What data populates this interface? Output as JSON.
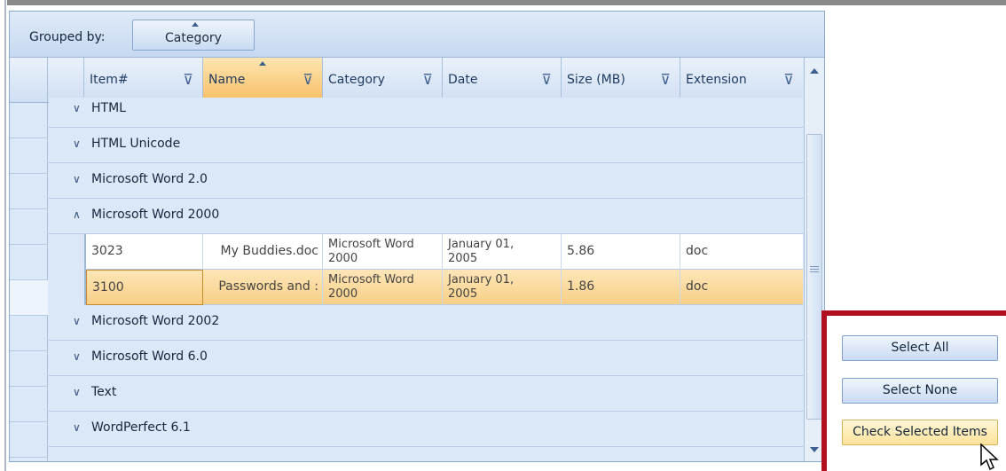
{
  "group_panel": {
    "label": "Grouped by:",
    "chip": "Category"
  },
  "columns": [
    {
      "label": "Item#",
      "sorted": false
    },
    {
      "label": "Name",
      "sorted": true
    },
    {
      "label": "Category",
      "sorted": false
    },
    {
      "label": "Date",
      "sorted": false
    },
    {
      "label": "Size (MB)",
      "sorted": false
    },
    {
      "label": "Extension",
      "sorted": false
    }
  ],
  "groups": [
    {
      "label": "HTML",
      "expanded": false
    },
    {
      "label": "HTML Unicode",
      "expanded": false
    },
    {
      "label": "Microsoft Word 2.0",
      "expanded": false
    },
    {
      "label": "Microsoft Word 2000",
      "expanded": true
    },
    {
      "label": "Microsoft Word 2002",
      "expanded": false
    },
    {
      "label": "Microsoft Word 6.0",
      "expanded": false
    },
    {
      "label": "Text",
      "expanded": false
    },
    {
      "label": "WordPerfect 6.1",
      "expanded": false
    }
  ],
  "rows": [
    {
      "item": "3023",
      "name": "My Buddies.doc",
      "category_line1": "Microsoft Word",
      "category_line2": "2000",
      "date_line1": "January 01,",
      "date_line2": "2005",
      "size": "5.86",
      "extension": "doc",
      "selected": false
    },
    {
      "item": "3100",
      "name": "Passwords and :",
      "category_line1": "Microsoft Word",
      "category_line2": "2000",
      "date_line1": "January 01,",
      "date_line2": "2005",
      "size": "1.86",
      "extension": "doc",
      "selected": true
    }
  ],
  "buttons": {
    "select_all": "Select All",
    "select_none": "Select None",
    "check_selected": "Check Selected Items"
  },
  "colors": {
    "selected_row": "#f9cf86",
    "highlight_border": "#b01020",
    "hot_button": "#fde29a"
  },
  "icons": {
    "filter": "filter-funnel",
    "expand": "chevron-down",
    "collapse": "chevron-up",
    "sort": "sort-ascending"
  }
}
